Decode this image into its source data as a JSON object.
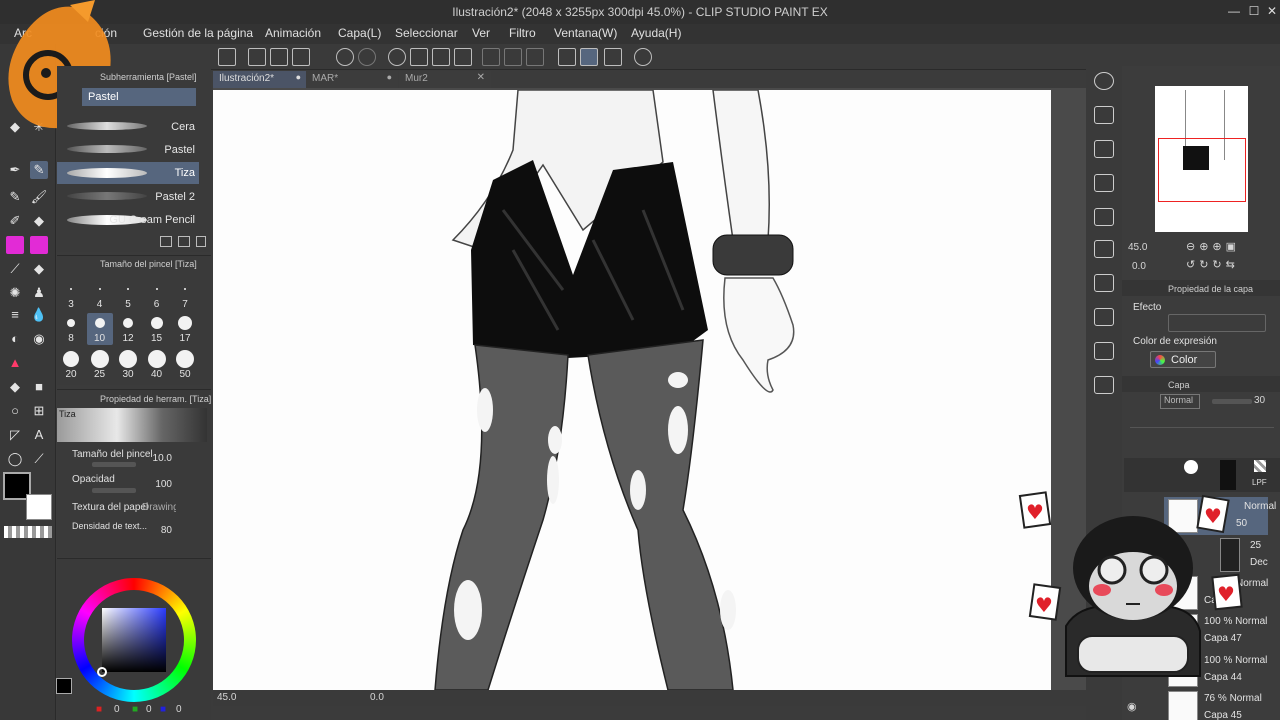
{
  "window": {
    "title": "Ilustración2* (2048 x 3255px 300dpi 45.0%)  - CLIP STUDIO PAINT EX",
    "minimize": "—",
    "maximize": "☐",
    "close": "✕"
  },
  "menu": {
    "items": [
      "Arc",
      "ción",
      "Gestión de la página",
      "Animación",
      "Capa(L)",
      "Seleccionar",
      "Ver",
      "Filtro",
      "Ventana(W)",
      "Ayuda(H)"
    ]
  },
  "doc_tabs": [
    {
      "label": "Ilustración2*",
      "active": true
    },
    {
      "label": "MAR*",
      "active": false
    },
    {
      "label": "Mur2",
      "active": false
    }
  ],
  "tab_close": "✕",
  "subtool": {
    "title": "Subherramienta [Pastel]",
    "group_label": "Pastel",
    "items": [
      "Cera",
      "Pastel",
      "Tiza",
      "Pastel 2",
      "GU Cream Pencil"
    ]
  },
  "brush_size": {
    "title": "Tamaño del pincel [Tiza]",
    "sizes": [
      3,
      4,
      5,
      6,
      7,
      8,
      10,
      12,
      15,
      17,
      20,
      25,
      30,
      40,
      50
    ],
    "selected": 10
  },
  "tool_property": {
    "title": "Propiedad de herram. [Tiza]",
    "preview_label": "Tiza",
    "brush_size_label": "Tamaño del pincel",
    "brush_size_value": "10.0",
    "opacity_label": "Opacidad",
    "opacity_value": "100",
    "paper_texture_label": "Textura del papel",
    "paper_texture_value": "Drawing",
    "texture_density_label": "Densidad de text...",
    "texture_density_value": "80"
  },
  "color": {
    "main": "#000000",
    "sub": "#ffffff",
    "rgb_values": [
      "0",
      "0",
      "0"
    ]
  },
  "status": {
    "zoom": "45.0",
    "rotation": "0.0"
  },
  "navigator": {
    "zoom": "45.0",
    "rotation": "0.0"
  },
  "layer_property": {
    "title": "Propiedad de la capa",
    "effect_label": "Efecto",
    "expression_label": "Color de expresión",
    "expression_value": "Color"
  },
  "layer_panel": {
    "title": "Capa",
    "blend_mode": "Normal",
    "opacity": "30",
    "top_badge": "LPF",
    "layers": [
      {
        "line1": "Normal",
        "line2": "50"
      },
      {
        "line1": "25",
        "line2": "Dec"
      },
      {
        "line1": "Normal",
        "line2": "Ca"
      },
      {
        "line1": "100 % Normal",
        "line2": "Capa 47"
      },
      {
        "line1": "100 % Normal",
        "line2": "Capa 44"
      },
      {
        "line1": "76 % Normal",
        "line2": "Capa 45"
      }
    ]
  },
  "accent_colors": {
    "selection": "#56667e",
    "magenta_tool": "#e22bd6",
    "orange_fish": "#f28c1e",
    "heart": "#e0202a"
  }
}
